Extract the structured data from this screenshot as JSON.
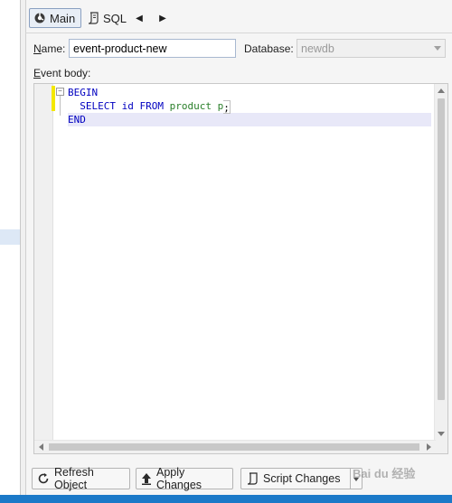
{
  "toolbar": {
    "main_label": "Main",
    "sql_label": "SQL",
    "prev_glyph": "◀",
    "next_glyph": "▶"
  },
  "form": {
    "name_label_underlined": "N",
    "name_label_rest": "ame:",
    "name_value": "event-product-new",
    "database_label_prefix": "Database",
    "database_label_suffix": ":",
    "database_value": "newdb",
    "event_body_label_underlined": "E",
    "event_body_label_rest": "vent body:"
  },
  "editor": {
    "lines": [
      {
        "text": "BEGIN"
      },
      {
        "pre": "  SELECT id FROM ",
        "ident": "product p",
        "post": ";"
      },
      {
        "text": "END"
      }
    ]
  },
  "buttons": {
    "refresh_label": "Refresh Object",
    "apply_label": "Apply Changes",
    "script_label": "Script Changes"
  },
  "watermark": {
    "text": "Bai du 经验"
  },
  "icons": {
    "main": "main-tab-icon",
    "sql": "sql-script-icon",
    "refresh": "refresh-icon",
    "apply": "apply-up-arrow-icon",
    "script": "script-icon"
  },
  "colors": {
    "accent": "#1b79c8",
    "keyword": "#0000c0",
    "identifier": "#2a7f2a",
    "change_marker": "#f4e800",
    "current_line": "#e8e8f8"
  }
}
